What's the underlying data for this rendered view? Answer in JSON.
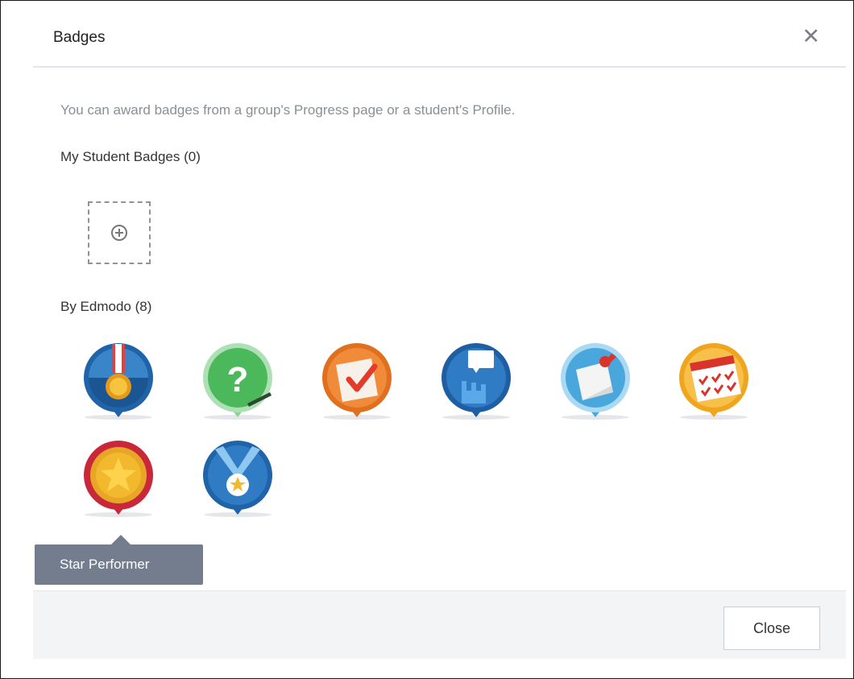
{
  "modal": {
    "title": "Badges",
    "intro": "You can award badges from a group's Progress page or a student's Profile.",
    "my_badges_heading": "My Student Badges (0)",
    "edmodo_heading": "By Edmodo (8)"
  },
  "edmodo_badges": [
    {
      "icon": "medal-ribbon-icon",
      "color": "#1f63a8"
    },
    {
      "icon": "question-mark-icon",
      "color": "#4cb85c"
    },
    {
      "icon": "checklist-icon",
      "color": "#e0701f"
    },
    {
      "icon": "raised-hand-icon",
      "color": "#1f5ea3"
    },
    {
      "icon": "pinned-note-icon",
      "color": "#4aa7dc"
    },
    {
      "icon": "calendar-checks-icon",
      "color": "#f0a51f"
    },
    {
      "icon": "star-medal-icon",
      "color": "#c8283a"
    },
    {
      "icon": "star-ribbon-icon",
      "color": "#1f63a8"
    }
  ],
  "tooltip": {
    "text": "Star Performer"
  },
  "footer": {
    "close_label": "Close"
  }
}
